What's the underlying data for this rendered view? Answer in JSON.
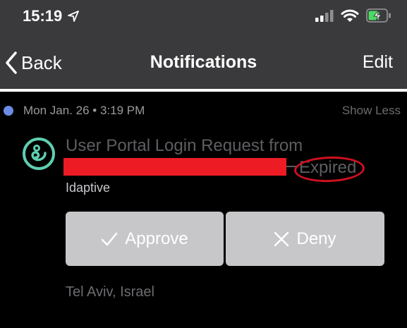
{
  "status_bar": {
    "time": "15:19",
    "icons": [
      "location-arrow-icon",
      "cellular-signal-icon",
      "wifi-icon",
      "battery-charging-icon"
    ]
  },
  "nav": {
    "back_label": "Back",
    "title": "Notifications",
    "edit_label": "Edit"
  },
  "notification": {
    "date": "Mon Jan. 26 • 3:19 PM",
    "show_less_label": "Show Less",
    "title": "User Portal Login Request from",
    "status": "Expired",
    "app_name": "Idaptive",
    "approve_label": "Approve",
    "deny_label": "Deny",
    "location": "Tel Aviv, Israel"
  },
  "colors": {
    "bar_background": "#3a3a3c",
    "unread_dot": "#6b8ce4",
    "app_icon": "#5fcfb0",
    "redaction": "#ed1c24",
    "annotation_circle": "#d01020",
    "button_background": "#c7c7c9",
    "battery_green": "#4cd964"
  }
}
